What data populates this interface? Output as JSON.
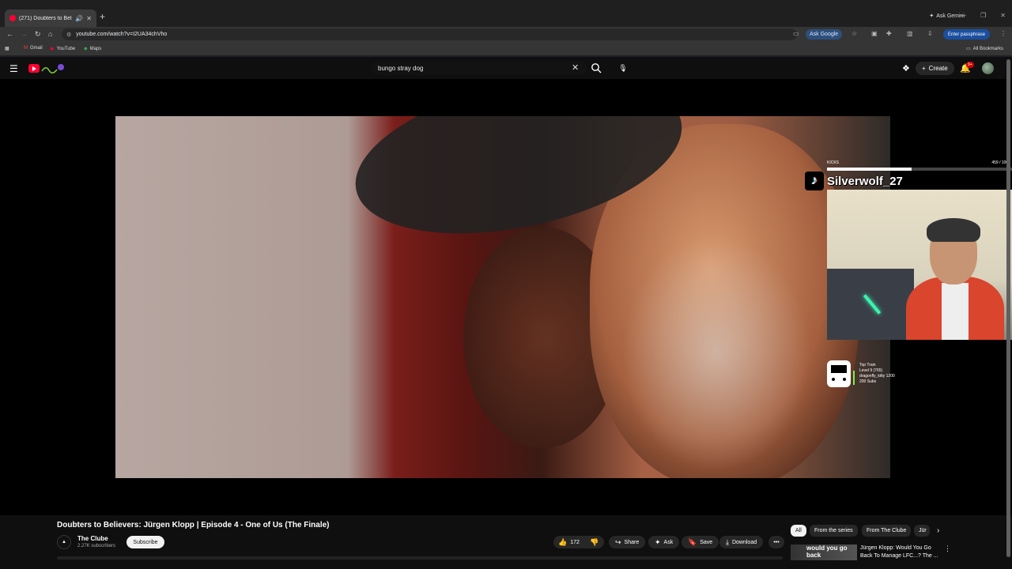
{
  "browser": {
    "tab_title": "(271) Doubters to Believers:",
    "ask_gemini": "Ask Gemini",
    "url": "youtube.com/watch?v=I2UA34chVho",
    "ask_google": "Ask Google",
    "passphrase": "Enter passphrase",
    "bookmarks": [
      "Gmail",
      "YouTube",
      "Maps"
    ],
    "all_bookmarks": "All Bookmarks"
  },
  "youtube": {
    "search_value": "bungo stray dog",
    "create_label": "Create",
    "notif_count": "9+"
  },
  "overlay": {
    "kicks_label": "KICKS",
    "kicks_value": "459",
    "kicks_max": "/ 1000",
    "kicks_fraction": 0.459,
    "tiktok_user": "Silverwolf_27",
    "train_lines": [
      "Top Train",
      "Level 9  (765)",
      "dragonfly_kitty 1200",
      "200 Subs"
    ]
  },
  "video": {
    "title": "Doubters to Believers: Jürgen Klopp | Episode 4 - One of Us (The Finale)",
    "channel": "The Clube",
    "subscribers": "2.27K subscribers",
    "subscribe_label": "Subscribe",
    "likes": "172",
    "share_label": "Share",
    "ask_label": "Ask",
    "save_label": "Save",
    "download_label": "Download"
  },
  "chips": [
    "All",
    "From the series",
    "From The Clube",
    "Jür"
  ],
  "recommendation": {
    "thumb_text": "would you go back",
    "title": "Jürgen Klopp: Would You Go Back To Manage LFC...? The ..."
  }
}
